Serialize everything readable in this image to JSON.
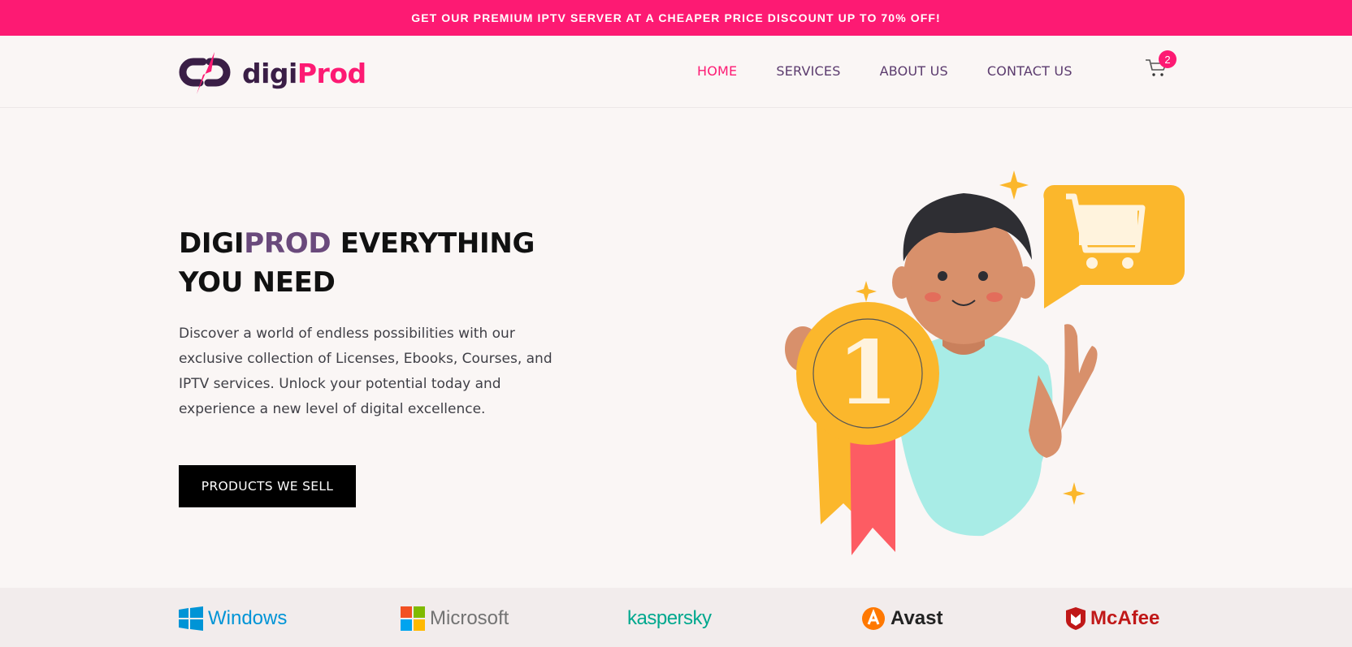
{
  "promo": {
    "text": "GET OUR PREMIUM IPTV SERVER AT A CHEAPER PRICE DISCOUNT UP TO 70% OFF!"
  },
  "logo": {
    "part1": "digi",
    "part2": "Prod"
  },
  "nav": {
    "items": [
      "HOME",
      "SERVICES",
      "ABOUT US",
      "CONTACT US"
    ],
    "active": "HOME"
  },
  "cart": {
    "count": "2",
    "icon": "cart-icon"
  },
  "hero": {
    "title_part1": "DIGI",
    "title_accent": "PROD",
    "title_part2": " EVERYTHING YOU NEED",
    "description": "Discover a world of endless possibilities with our exclusive collection of Licenses, Ebooks, Courses, and IPTV services. Unlock your potential today and experience a new level of digital excellence.",
    "cta": "PRODUCTS WE SELL",
    "medal_number": "1"
  },
  "brands": [
    "Windows",
    "Microsoft",
    "kaspersky",
    "Avast",
    "McAfee"
  ],
  "colors": {
    "brand_pink": "#fd1a73",
    "brand_purple": "#6a4a7c",
    "background": "#faf6f5"
  }
}
